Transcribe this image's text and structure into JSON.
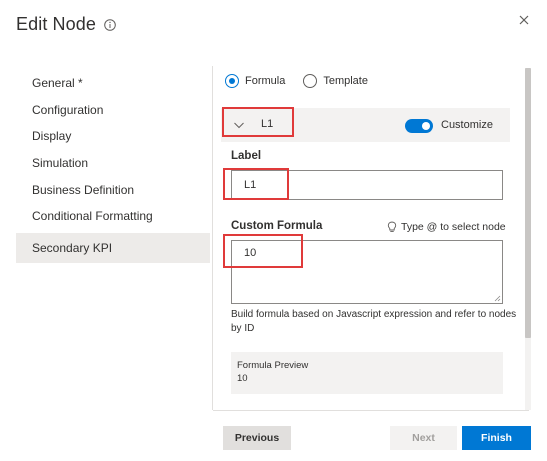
{
  "dialog": {
    "title": "Edit Node"
  },
  "nav": {
    "items": [
      {
        "label": "General *"
      },
      {
        "label": "Configuration"
      },
      {
        "label": "Display"
      },
      {
        "label": "Simulation"
      },
      {
        "label": "Business Definition"
      },
      {
        "label": "Conditional Formatting"
      },
      {
        "label": "Secondary KPI"
      }
    ],
    "selected": "Secondary KPI"
  },
  "mode": {
    "options": [
      "Formula",
      "Template"
    ],
    "selected": "Formula"
  },
  "kpi": {
    "name": "L1",
    "customize_label": "Customize",
    "customize_on": true
  },
  "label_field": {
    "label": "Label",
    "value": "L1"
  },
  "formula_field": {
    "label": "Custom Formula",
    "hint": "Type @ to select node",
    "value": "10",
    "help": "Build formula based on Javascript expression and refer to nodes by ID"
  },
  "preview": {
    "title": "Formula Preview",
    "value": "10"
  },
  "buttons": {
    "previous": "Previous",
    "next": "Next",
    "finish": "Finish"
  },
  "colors": {
    "accent": "#0078d4",
    "highlight_box": "#e03a3a",
    "selected_nav_bg": "#edebe9"
  }
}
